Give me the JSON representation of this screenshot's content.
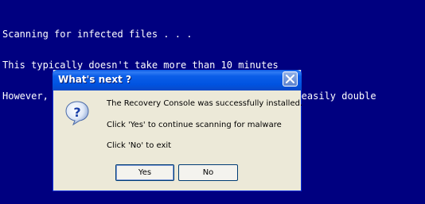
{
  "console": {
    "lines": [
      "Scanning for infected files . . .",
      "This typically doesn't take more than 10 minutes",
      "However, scan times for badly infected machines may easily double"
    ]
  },
  "dialog": {
    "title": "What's next ?",
    "icon": "question-icon",
    "messages": [
      "The Recovery Console was successfully installed.",
      "Click 'Yes' to continue scanning for malware",
      "Click 'No' to exit"
    ],
    "yes_label": "Yes",
    "no_label": "No"
  }
}
